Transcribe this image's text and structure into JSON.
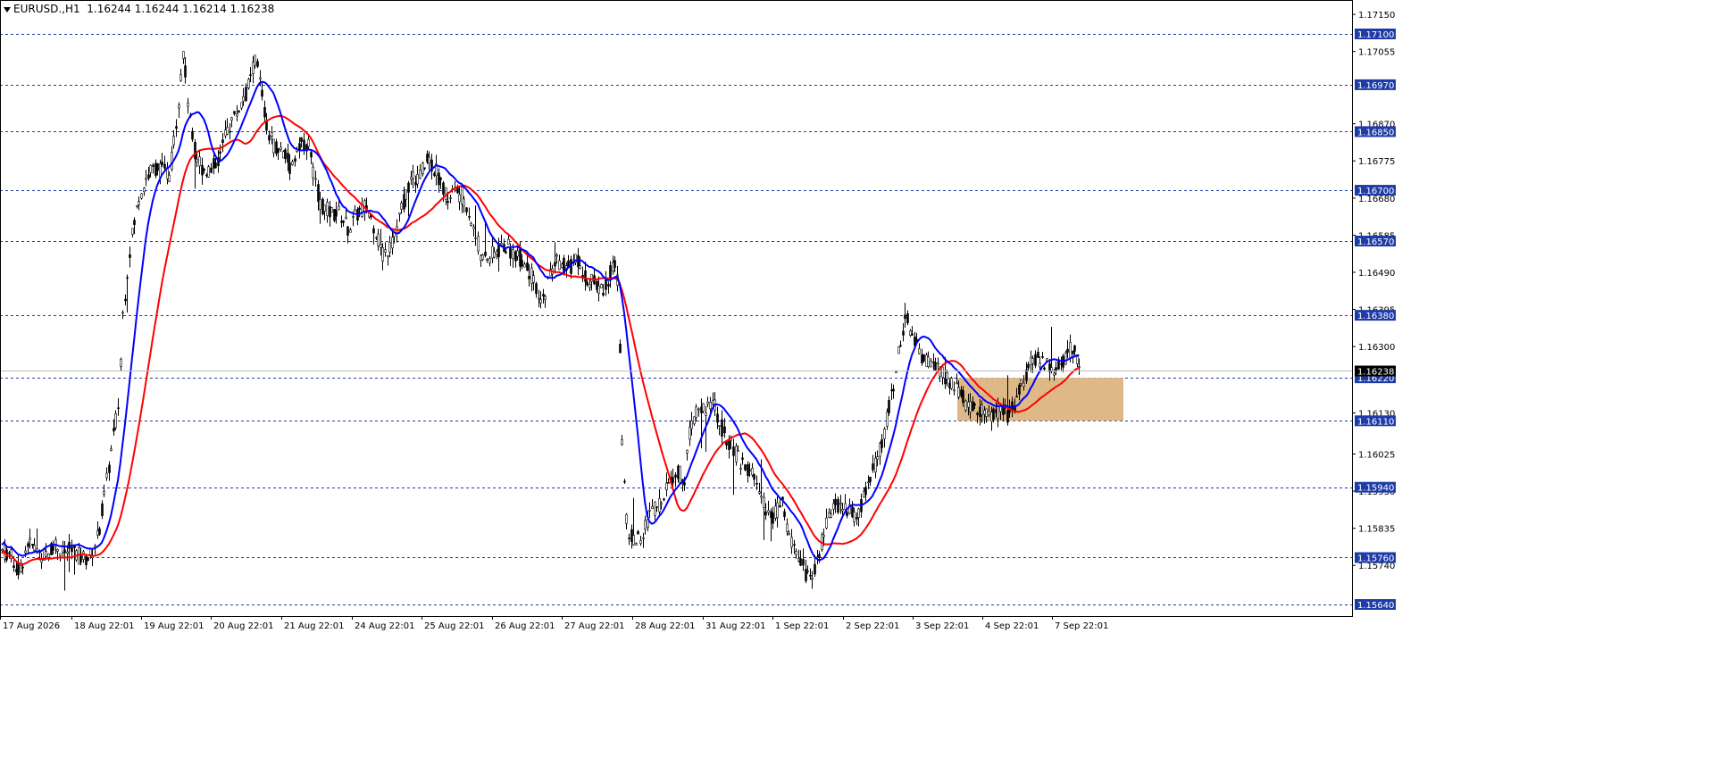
{
  "header": {
    "symbol": "EURUSD.,H1",
    "ohlc": "1.16244 1.16244 1.16214 1.16238"
  },
  "colors": {
    "grid_level": "#1e3ca8",
    "ma_fast": "#0000ff",
    "ma_slow": "#ff0000",
    "zone_fill": "#deb887",
    "candle": "#000000",
    "price_label_bg": "#1e3ca8",
    "current_price_bg": "#000000"
  },
  "chart_data": {
    "type": "candlestick",
    "y_axis_ticks": [
      "1.17150",
      "1.17055",
      "1.16870",
      "1.16775",
      "1.16680",
      "1.16585",
      "1.16490",
      "1.16395",
      "1.16300",
      "1.16130",
      "1.16025",
      "1.15930",
      "1.15835",
      "1.15740"
    ],
    "x_axis_labels": [
      "17 Aug 2026",
      "18 Aug 22:01",
      "19 Aug 22:01",
      "20 Aug 22:01",
      "21 Aug 22:01",
      "24 Aug 22:01",
      "25 Aug 22:01",
      "26 Aug 22:01",
      "27 Aug 22:01",
      "28 Aug 22:01",
      "31 Aug 22:01",
      "1 Sep 22:01",
      "2 Sep 22:01",
      "3 Sep 22:01",
      "4 Sep 22:01",
      "7 Sep 22:01"
    ],
    "horizontal_levels": [
      "1.17100",
      "1.16970",
      "1.16850",
      "1.16700",
      "1.16570",
      "1.16380",
      "1.16220",
      "1.16110",
      "1.15940",
      "1.15760",
      "1.15640"
    ],
    "current_price": "1.16238",
    "zone": {
      "from_price": 1.1611,
      "to_price": 1.1622
    },
    "path_points": [
      [
        0,
        1.1578
      ],
      [
        10,
        1.1577
      ],
      [
        22,
        1.1572
      ],
      [
        30,
        1.158
      ],
      [
        40,
        1.1578
      ],
      [
        52,
        1.1576
      ],
      [
        60,
        1.158
      ],
      [
        70,
        1.1577
      ],
      [
        80,
        1.1578
      ],
      [
        90,
        1.1576
      ],
      [
        100,
        1.1576
      ],
      [
        110,
        1.1582
      ],
      [
        122,
        1.16
      ],
      [
        132,
        1.1615
      ],
      [
        137,
        1.1638
      ],
      [
        145,
        1.1655
      ],
      [
        155,
        1.1668
      ],
      [
        165,
        1.1674
      ],
      [
        175,
        1.1676
      ],
      [
        190,
        1.1674
      ],
      [
        200,
        1.1694
      ],
      [
        205,
        1.1706
      ],
      [
        212,
        1.1688
      ],
      [
        218,
        1.168
      ],
      [
        225,
        1.1676
      ],
      [
        235,
        1.1675
      ],
      [
        245,
        1.1678
      ],
      [
        255,
        1.1686
      ],
      [
        265,
        1.169
      ],
      [
        272,
        1.1693
      ],
      [
        280,
        1.1698
      ],
      [
        286,
        1.1704
      ],
      [
        292,
        1.1696
      ],
      [
        298,
        1.1686
      ],
      [
        305,
        1.1682
      ],
      [
        315,
        1.168
      ],
      [
        325,
        1.1676
      ],
      [
        335,
        1.1682
      ],
      [
        345,
        1.1682
      ],
      [
        352,
        1.1672
      ],
      [
        360,
        1.1666
      ],
      [
        370,
        1.1664
      ],
      [
        380,
        1.1664
      ],
      [
        390,
        1.166
      ],
      [
        400,
        1.1664
      ],
      [
        410,
        1.1666
      ],
      [
        420,
        1.166
      ],
      [
        428,
        1.1653
      ],
      [
        438,
        1.1656
      ],
      [
        448,
        1.1664
      ],
      [
        458,
        1.1672
      ],
      [
        470,
        1.1674
      ],
      [
        480,
        1.1678
      ],
      [
        490,
        1.1674
      ],
      [
        500,
        1.1668
      ],
      [
        510,
        1.167
      ],
      [
        520,
        1.1668
      ],
      [
        530,
        1.166
      ],
      [
        540,
        1.1652
      ],
      [
        555,
        1.1654
      ],
      [
        565,
        1.1656
      ],
      [
        575,
        1.1654
      ],
      [
        585,
        1.1652
      ],
      [
        595,
        1.1648
      ],
      [
        605,
        1.164
      ],
      [
        615,
        1.1648
      ],
      [
        625,
        1.1652
      ],
      [
        635,
        1.165
      ],
      [
        645,
        1.1652
      ],
      [
        655,
        1.1648
      ],
      [
        665,
        1.1646
      ],
      [
        675,
        1.1644
      ],
      [
        685,
        1.165
      ],
      [
        690,
        1.1652
      ],
      [
        693,
        1.1635
      ],
      [
        697,
        1.16
      ],
      [
        703,
        1.1582
      ],
      [
        710,
        1.158
      ],
      [
        718,
        1.1582
      ],
      [
        728,
        1.1587
      ],
      [
        738,
        1.159
      ],
      [
        748,
        1.1596
      ],
      [
        758,
        1.1598
      ],
      [
        766,
        1.1596
      ],
      [
        772,
        1.1608
      ],
      [
        780,
        1.1614
      ],
      [
        790,
        1.1614
      ],
      [
        798,
        1.1616
      ],
      [
        806,
        1.161
      ],
      [
        815,
        1.1606
      ],
      [
        825,
        1.1602
      ],
      [
        835,
        1.1598
      ],
      [
        845,
        1.1596
      ],
      [
        855,
        1.159
      ],
      [
        865,
        1.1586
      ],
      [
        875,
        1.159
      ],
      [
        885,
        1.158
      ],
      [
        895,
        1.1576
      ],
      [
        905,
        1.157
      ],
      [
        912,
        1.1574
      ],
      [
        920,
        1.158
      ],
      [
        930,
        1.1588
      ],
      [
        940,
        1.159
      ],
      [
        950,
        1.1588
      ],
      [
        960,
        1.1586
      ],
      [
        970,
        1.1594
      ],
      [
        980,
        1.16
      ],
      [
        990,
        1.1608
      ],
      [
        1000,
        1.162
      ],
      [
        1008,
        1.1632
      ],
      [
        1015,
        1.1637
      ],
      [
        1022,
        1.1632
      ],
      [
        1030,
        1.1628
      ],
      [
        1040,
        1.1626
      ],
      [
        1050,
        1.1624
      ],
      [
        1060,
        1.1622
      ],
      [
        1070,
        1.162
      ],
      [
        1080,
        1.1616
      ],
      [
        1090,
        1.1614
      ],
      [
        1100,
        1.1614
      ],
      [
        1110,
        1.1612
      ],
      [
        1120,
        1.1614
      ],
      [
        1130,
        1.1612
      ],
      [
        1140,
        1.1618
      ],
      [
        1150,
        1.1624
      ],
      [
        1160,
        1.1627
      ],
      [
        1170,
        1.1626
      ],
      [
        1180,
        1.1624
      ],
      [
        1190,
        1.1626
      ],
      [
        1200,
        1.163
      ],
      [
        1206,
        1.1627
      ],
      [
        1210,
        1.1624
      ]
    ]
  }
}
